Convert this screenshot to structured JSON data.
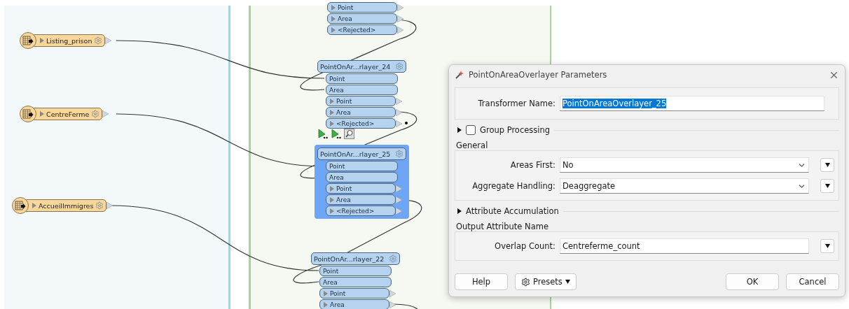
{
  "readers": [
    {
      "name": "Listing_prison"
    },
    {
      "name": "CentreFerme"
    },
    {
      "name": "AccueilImmigres"
    }
  ],
  "transformers": [
    {
      "selected": false,
      "outputs": [
        "Point",
        "Area",
        "<Rejected>"
      ]
    },
    {
      "title": "PointOnAr...rlayer_24",
      "selected": false,
      "inputs": [
        "Point",
        "Area"
      ],
      "outputs": [
        "Point",
        "Area",
        "<Rejected>"
      ]
    },
    {
      "title": "PointOnAr...rlayer_25",
      "selected": true,
      "inputs": [
        "Point",
        "Area"
      ],
      "outputs": [
        "Point",
        "Area",
        "<Rejected>"
      ]
    },
    {
      "title": "PointOnAr...rlayer_22",
      "selected": false,
      "inputs": [
        "Point",
        "Area"
      ],
      "outputs": [
        "Point",
        "Area"
      ]
    }
  ],
  "dialog": {
    "title": "PointOnAreaOverlayer Parameters",
    "transformer_name": {
      "label": "Transformer Name:",
      "value": "PointOnAreaOverlayer_25",
      "selected": true
    },
    "group_processing": {
      "label": "Group Processing",
      "checked": false,
      "expanded": false
    },
    "general": {
      "title": "General",
      "rows": [
        {
          "label": "Areas First:",
          "value": "No",
          "kind": "select"
        },
        {
          "label": "Aggregate Handling:",
          "value": "Deaggregate",
          "kind": "select"
        }
      ]
    },
    "attribute_accumulation": {
      "label": "Attribute Accumulation",
      "expanded": false
    },
    "output": {
      "title": "Output Attribute Name",
      "rows": [
        {
          "label": "Overlap Count:",
          "value": "Centreferme_count",
          "kind": "text"
        }
      ]
    },
    "buttons_left": [
      {
        "label": "Help",
        "kind": "plain"
      },
      {
        "label": "Presets",
        "kind": "menu"
      }
    ],
    "buttons_right": [
      {
        "label": "OK",
        "kind": "plain"
      },
      {
        "label": "Cancel",
        "kind": "plain"
      }
    ]
  }
}
